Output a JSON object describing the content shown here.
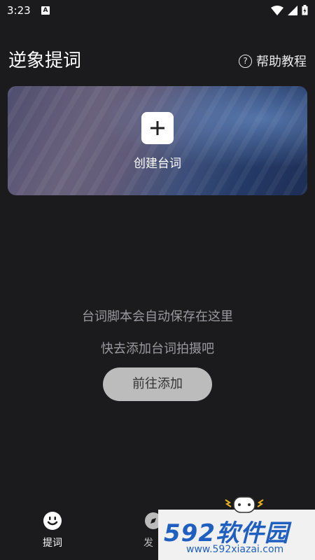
{
  "status_bar": {
    "time": "3:23",
    "notif_badge": "A"
  },
  "header": {
    "title": "逆象提词",
    "help_label": "帮助教程",
    "help_icon_glyph": "?"
  },
  "banner": {
    "create_label": "创建台词"
  },
  "empty_state": {
    "line1": "台词脚本会自动保存在这里",
    "line2": "快去添加台词拍摄吧",
    "button_label": "前往添加"
  },
  "bottom_nav": {
    "tabs": [
      {
        "label": "提词",
        "icon": "smiley-icon",
        "active": true
      },
      {
        "label": "发",
        "icon": "discover-icon",
        "active": false
      }
    ]
  },
  "watermark": {
    "brand": "592软件园",
    "url": "www.592xiazai.com"
  },
  "colors": {
    "background": "#1b1b1e",
    "button": "#bcbcbc",
    "watermark_blue": "#1f5fc0"
  }
}
